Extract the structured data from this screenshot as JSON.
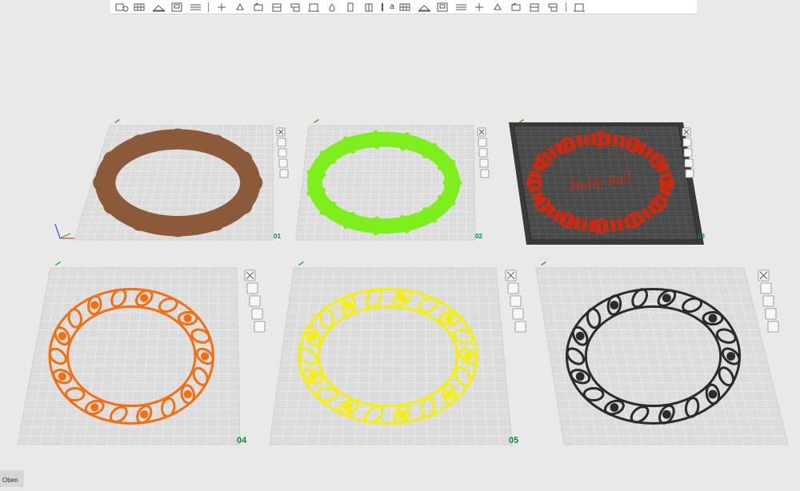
{
  "toolbar": {
    "items": [
      {
        "name": "add-object-icon",
        "sep": false
      },
      {
        "name": "arrange-grid-icon",
        "sep": false
      },
      {
        "name": "orient-icon",
        "sep": false
      },
      {
        "name": "layout-icon",
        "sep": false
      },
      {
        "name": "layers-icon",
        "sep": true
      },
      {
        "name": "move-icon",
        "sep": false
      },
      {
        "name": "rotate-icon",
        "sep": false
      },
      {
        "name": "scale-icon",
        "sep": false
      },
      {
        "name": "lay-on-face-icon",
        "sep": false
      },
      {
        "name": "cut-icon",
        "sep": false
      },
      {
        "name": "mesh-boolean-icon",
        "sep": false
      },
      {
        "name": "support-paint-icon",
        "sep": false
      },
      {
        "name": "seam-paint-icon",
        "sep": false
      },
      {
        "name": "color-paint-icon",
        "sep": false
      },
      {
        "name": "text-icon",
        "sep": false,
        "text": "a"
      },
      {
        "name": "split-objects-icon",
        "sep": false
      },
      {
        "name": "split-parts-icon",
        "sep": false
      },
      {
        "name": "variable-height-icon",
        "sep": false
      },
      {
        "name": "assembly-icon",
        "sep": false
      },
      {
        "name": "measure-icon",
        "sep": false
      },
      {
        "name": "brim-ears-icon",
        "sep": false
      },
      {
        "name": "emboss-icon",
        "sep": false
      },
      {
        "name": "svg-icon",
        "sep": false
      },
      {
        "name": "notes-icon",
        "sep": true
      },
      {
        "name": "view-mode-icon",
        "sep": false
      }
    ]
  },
  "plates": [
    {
      "label": "01",
      "color": "#8b5a3a",
      "style": "silhouette",
      "bed": "light"
    },
    {
      "label": "02",
      "color": "#7fee1d",
      "style": "leaves",
      "bed": "light"
    },
    {
      "label": "03",
      "color": "#cc2a10",
      "style": "text",
      "bed": "dark",
      "text": "Hello Fall"
    },
    {
      "label": "04",
      "color": "#f27011",
      "style": "ornate",
      "bed": "light"
    },
    {
      "label": "05",
      "color": "#f5f00a",
      "style": "ornate",
      "bed": "light"
    },
    {
      "label": "",
      "color": "#2b2b2b",
      "style": "ornate",
      "bed": "light"
    }
  ],
  "view_label": "Oben",
  "colors": {
    "accent": "#19a34a",
    "label_green": "#0d8a3a",
    "bed_dark": "#4a4a4a"
  }
}
